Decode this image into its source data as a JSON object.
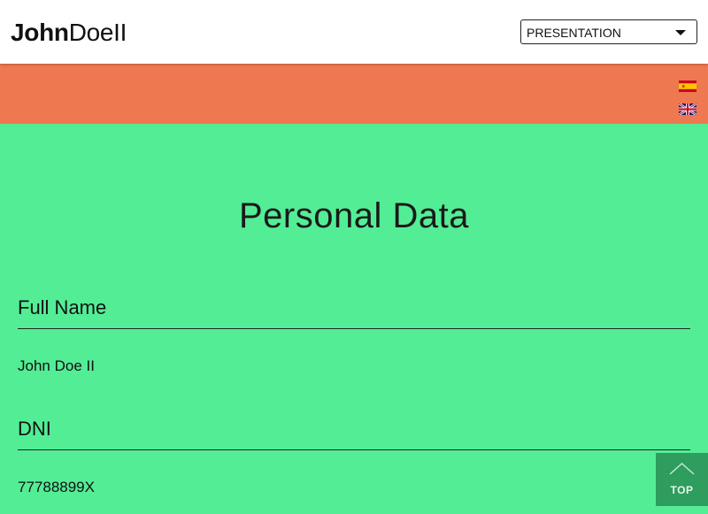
{
  "header": {
    "logo_bold": "John",
    "logo_light": "DoeII",
    "section_select": {
      "value": "PRESENTATION",
      "icon": "chevron-down-icon"
    }
  },
  "languages": [
    {
      "code": "es",
      "icon": "flag-spain-icon"
    },
    {
      "code": "en",
      "icon": "flag-uk-icon"
    }
  ],
  "main": {
    "title": "Personal Data",
    "fields": [
      {
        "label": "Full Name",
        "value": "John Doe II"
      },
      {
        "label": "DNI",
        "value": "77788899X"
      }
    ]
  },
  "back_to_top": {
    "label": "TOP",
    "icon": "chevron-up-icon"
  },
  "colors": {
    "header_bg": "#ffffff",
    "band_bg": "#ee7850",
    "main_bg": "#53ed96",
    "top_button_bg": "#2e9d5d"
  }
}
